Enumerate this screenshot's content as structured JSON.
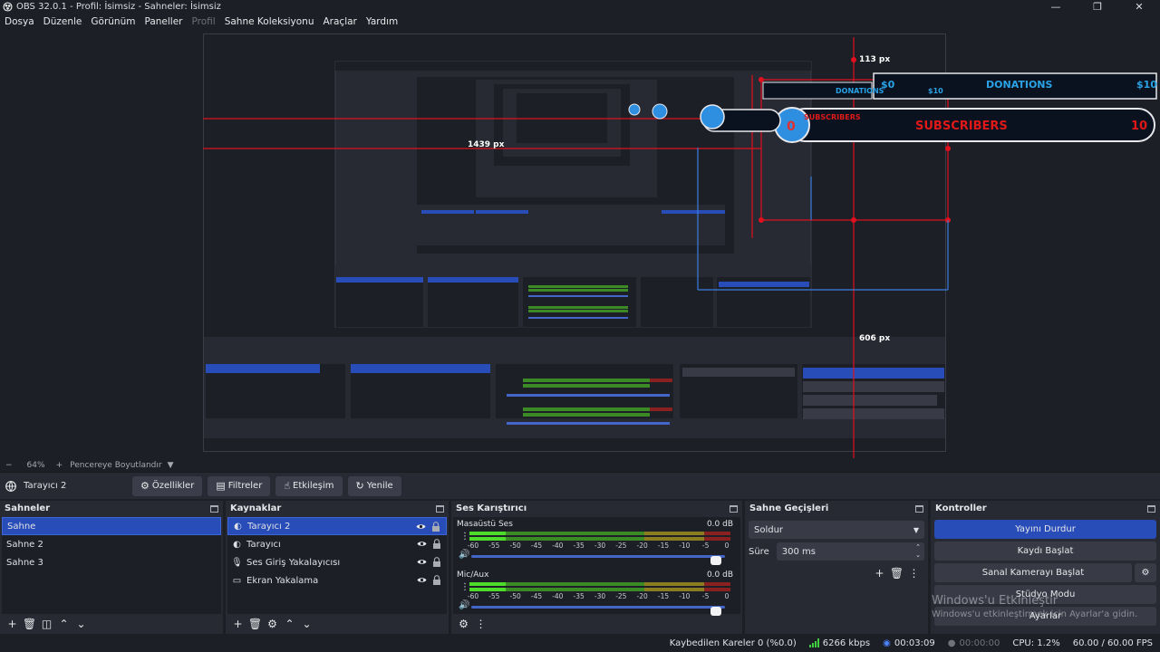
{
  "window": {
    "title": "OBS 32.0.1 - Profil: İsimsiz - Sahneler: İsimsiz",
    "minimize": "—",
    "maximize": "❐",
    "close": "✕"
  },
  "menu": [
    {
      "label": "Dosya",
      "enabled": true
    },
    {
      "label": "Düzenle",
      "enabled": true
    },
    {
      "label": "Görünüm",
      "enabled": true
    },
    {
      "label": "Paneller",
      "enabled": true
    },
    {
      "label": "Profil",
      "enabled": false
    },
    {
      "label": "Sahne Koleksiyonu",
      "enabled": true
    },
    {
      "label": "Araçlar",
      "enabled": true
    },
    {
      "label": "Yardım",
      "enabled": true
    }
  ],
  "preview": {
    "labels": {
      "top": "113 px",
      "left": "1439 px",
      "bottom": "606 px"
    },
    "donations": {
      "title": "DONATIONS",
      "left_value": "$0",
      "right_value": "$10"
    },
    "subscribers": {
      "title": "SUBSCRIBERS",
      "count": "0",
      "goal": "10"
    }
  },
  "zoom": {
    "minus": "−",
    "level": "64%",
    "plus": "+",
    "fit_label": "Pencereye Boyutlandır"
  },
  "context": {
    "source_name": "Tarayıcı 2",
    "buttons": {
      "properties": "Özellikler",
      "filters": "Filtreler",
      "interact": "Etkileşim",
      "refresh": "Yenile"
    }
  },
  "scenes": {
    "title": "Sahneler",
    "items": [
      "Sahne",
      "Sahne 2",
      "Sahne 3"
    ],
    "selected": 0
  },
  "sources": {
    "title": "Kaynaklar",
    "items": [
      {
        "label": "Tarayıcı 2",
        "icon": "globe-icon"
      },
      {
        "label": "Tarayıcı",
        "icon": "globe-icon"
      },
      {
        "label": "Ses Giriş Yakalayıcısı",
        "icon": "microphone-icon"
      },
      {
        "label": "Ekran Yakalama",
        "icon": "monitor-icon"
      }
    ],
    "selected": 0
  },
  "mixer": {
    "title": "Ses Karıştırıcı",
    "channels": [
      {
        "name": "Masaüstü Ses",
        "db": "0.0 dB",
        "level": 0.14
      },
      {
        "name": "Mic/Aux",
        "db": "0.0 dB",
        "level": 0.14
      }
    ],
    "ticks": [
      "-60",
      "-55",
      "-50",
      "-45",
      "-40",
      "-35",
      "-30",
      "-25",
      "-20",
      "-15",
      "-10",
      "-5",
      "0"
    ],
    "volume": 1.0
  },
  "transitions": {
    "title": "Sahne Geçişleri",
    "selected": "Soldur",
    "duration_label": "Süre",
    "duration_value": "300 ms"
  },
  "controls": {
    "title": "Kontroller",
    "stop_stream": "Yayını Durdur",
    "start_recording": "Kaydı Başlat",
    "virtual_camera": "Sanal Kamerayı Başlat",
    "studio_mode": "Stüdyo Modu",
    "settings": "Ayarlar"
  },
  "watermark": {
    "line1": "Windows'u Etkinleştir",
    "line2": "Windows'u etkinleştirmek için Ayarlar'a gidin."
  },
  "status": {
    "dropped_frames": "Kaybedilen Kareler 0 (%0.0)",
    "bitrate": "6266 kbps",
    "stream_time": "00:03:09",
    "record_time": "00:00:00",
    "cpu": "CPU: 1.2%",
    "fps": "60.00 / 60.00 FPS"
  },
  "colors": {
    "accent": "#284cb8",
    "panel": "#272a33",
    "background": "#1d1f26",
    "guide_red": "#e0101e",
    "guide_blue": "#3a7fe0",
    "donation_cyan": "#2aa3e6"
  }
}
